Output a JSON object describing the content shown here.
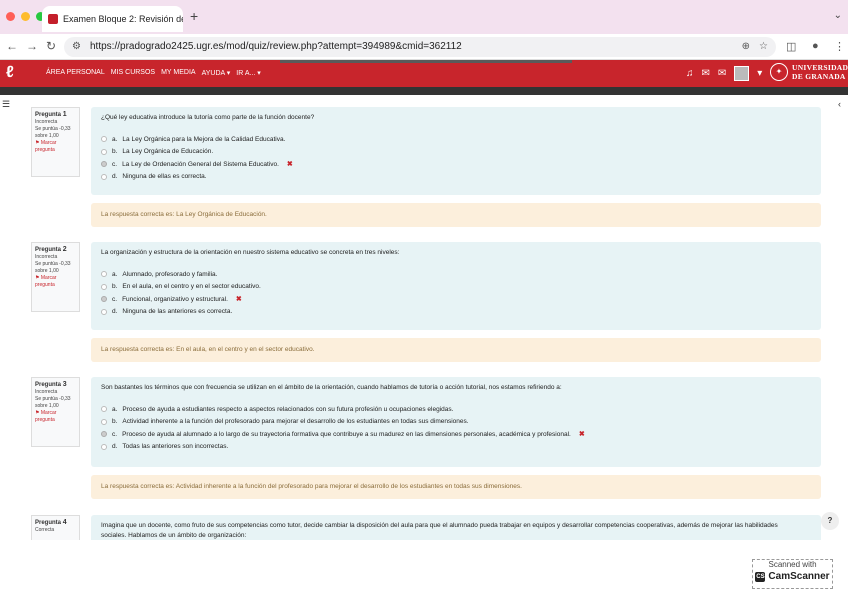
{
  "browser": {
    "tab_title": "Examen Bloque 2: Revisión de",
    "tab_close": "✕",
    "new_tab": "+",
    "url": "https://pradogrado2425.ugr.es/mod/quiz/review.php?attempt=394989&cmid=362112"
  },
  "moodle": {
    "nav": [
      "ÁREA PERSONAL",
      "MIS CURSOS",
      "MY MEDIA",
      "AYUDA ▾",
      "IR A... ▾"
    ],
    "university": [
      "UNIVERSIDAD",
      "DE GRANADA"
    ],
    "brand_color": "#c8252c"
  },
  "questions": [
    {
      "label": "Pregunta",
      "number": "1",
      "status": "Incorrecta",
      "score": "Se puntúa -0,33 sobre 1,00",
      "flag": "Marcar pregunta",
      "text": "¿Qué ley educativa introduce la tutoría como parte de la función docente?",
      "answers": [
        {
          "letter": "a.",
          "text": "La Ley Orgánica para la Mejora de la Calidad Educativa.",
          "selected": false
        },
        {
          "letter": "b.",
          "text": "La Ley Orgánica de Educación.",
          "selected": false
        },
        {
          "letter": "c.",
          "text": "La Ley de Ordenación General del Sistema Educativo.",
          "selected": true
        },
        {
          "letter": "d.",
          "text": "Ninguna de ellas es correcta.",
          "selected": false
        }
      ],
      "feedback": "La respuesta correcta es: La Ley Orgánica de Educación."
    },
    {
      "label": "Pregunta",
      "number": "2",
      "status": "Incorrecta",
      "score": "Se puntúa -0,33 sobre 1,00",
      "flag": "Marcar pregunta",
      "text": "La organización y estructura de la orientación en nuestro sistema educativo se concreta en tres niveles:",
      "answers": [
        {
          "letter": "a.",
          "text": "Alumnado, profesorado y familia.",
          "selected": false
        },
        {
          "letter": "b.",
          "text": "En el aula, en el centro y en el sector educativo.",
          "selected": false
        },
        {
          "letter": "c.",
          "text": "Funcional, organizativo y estructural.",
          "selected": true
        },
        {
          "letter": "d.",
          "text": "Ninguna de las anteriores es correcta.",
          "selected": false
        }
      ],
      "feedback": "La respuesta correcta es: En el aula, en el centro y en el sector educativo."
    },
    {
      "label": "Pregunta",
      "number": "3",
      "status": "Incorrecta",
      "score": "Se puntúa -0,33 sobre 1,00",
      "flag": "Marcar pregunta",
      "text": "Son bastantes los términos que con frecuencia se utilizan en el ámbito de la orientación, cuando hablamos de tutoría o acción tutorial, nos estamos refiriendo a:",
      "answers": [
        {
          "letter": "a.",
          "text": "Proceso de ayuda a estudiantes respecto a aspectos relacionados con su futura profesión u ocupaciones elegidas.",
          "selected": false
        },
        {
          "letter": "b.",
          "text": "Actividad inherente a la función del profesorado para mejorar el desarrollo de los estudiantes en todas sus dimensiones.",
          "selected": false
        },
        {
          "letter": "c.",
          "text": "Proceso de ayuda al alumnado a lo largo de su trayectoria formativa que contribuye a su madurez en las dimensiones personales, académica y profesional.",
          "selected": true
        },
        {
          "letter": "d.",
          "text": "Todas las anteriores son incorrectas.",
          "selected": false
        }
      ],
      "feedback": "La respuesta correcta es: Actividad inherente a la función del profesorado para mejorar el desarrollo de los estudiantes en todas sus dimensiones."
    },
    {
      "label": "Pregunta",
      "number": "4",
      "status": "Correcta",
      "text": "Imagina que un docente, como fruto de sus competencias como tutor, decide cambiar la disposición del aula para que el alumnado pueda trabajar en equipos y desarrollar competencias cooperativas, además de mejorar las habilidades sociales. Hablamos de un ámbito de organización:"
    }
  ],
  "help": "?",
  "watermark": {
    "line1": "Scanned with",
    "brand": "CamScanner"
  }
}
